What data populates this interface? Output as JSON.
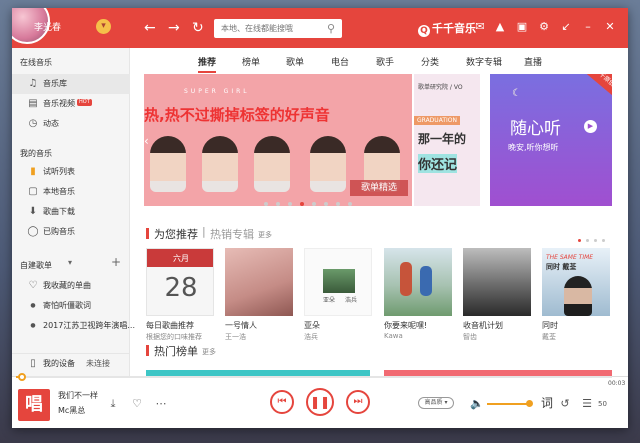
{
  "app": {
    "brand": "千千音乐",
    "username": "李光春",
    "search_placeholder": "本地、在线都能搜哦"
  },
  "sidebar": {
    "online_head": "在线音乐",
    "online_items": [
      {
        "label": "音乐库",
        "icon": "music-note-icon"
      },
      {
        "label": "音乐视频",
        "icon": "video-icon",
        "badge": "HOT"
      },
      {
        "label": "动态",
        "icon": "activity-icon"
      }
    ],
    "my_head": "我的音乐",
    "my_items": [
      {
        "label": "试听列表",
        "icon": "bars-icon"
      },
      {
        "label": "本地音乐",
        "icon": "monitor-icon"
      },
      {
        "label": "歌曲下载",
        "icon": "download-icon"
      },
      {
        "label": "已购音乐",
        "icon": "purchase-icon"
      }
    ],
    "playlist_head": "自建歌单",
    "playlists": [
      {
        "label": "我收藏的单曲",
        "icon": "heart-icon"
      },
      {
        "label": "寄怕听僵歌词"
      },
      {
        "label": "2017江苏卫视跨年演唱..."
      }
    ],
    "device": "我的设备",
    "device_status": "未连接"
  },
  "tabs": [
    "推荐",
    "榜单",
    "歌单",
    "电台",
    "歌手",
    "分类",
    "数字专辑",
    "直播"
  ],
  "active_tab": 0,
  "banner": {
    "main_title": "热,热不过撕掉标签的好声音",
    "main_sub": "SUPER GIRL",
    "main_tag": "歌单精选",
    "mid_title": "歌单研究院 / VO",
    "mid_label": "GRADUATION",
    "mid_line1": "那一年的",
    "mid_line2": "你还记",
    "right_tag": "千千原创",
    "right_title": "随心听",
    "right_sub": "晚安,听你想听",
    "dot_count": 8,
    "active_dot": 3
  },
  "recommend": {
    "title": "为您推荐",
    "sep": "|",
    "title2": "热销专辑",
    "more": "更多",
    "daily_month": "六月",
    "daily_day": "28",
    "cards": [
      {
        "title": "每日歌曲推荐",
        "artist": "根据您的口味推荐"
      },
      {
        "title": "一号情人",
        "artist": "王一浩"
      },
      {
        "title": "亚朵",
        "artist": "浩兵"
      },
      {
        "title": "你要来呢嘿!",
        "artist": "Kawa"
      },
      {
        "title": "收音机计划",
        "artist": "智齿"
      },
      {
        "title": "同时",
        "artist": "戴荃"
      }
    ],
    "card6_overlay": "THE SAME TIME",
    "card6_overlay2": "同时 戴荃",
    "card3_label": "亚朵",
    "card3_label2": "浩兵"
  },
  "hot": {
    "title": "热门榜单",
    "more": "更多"
  },
  "player": {
    "song": "我们不一样",
    "singer": "Mc黑总",
    "time": "00:03",
    "progress": 0.005,
    "cover_text": "唱",
    "quality": "高品质",
    "lyric": "词",
    "count": "50",
    "volume": 0.85
  }
}
